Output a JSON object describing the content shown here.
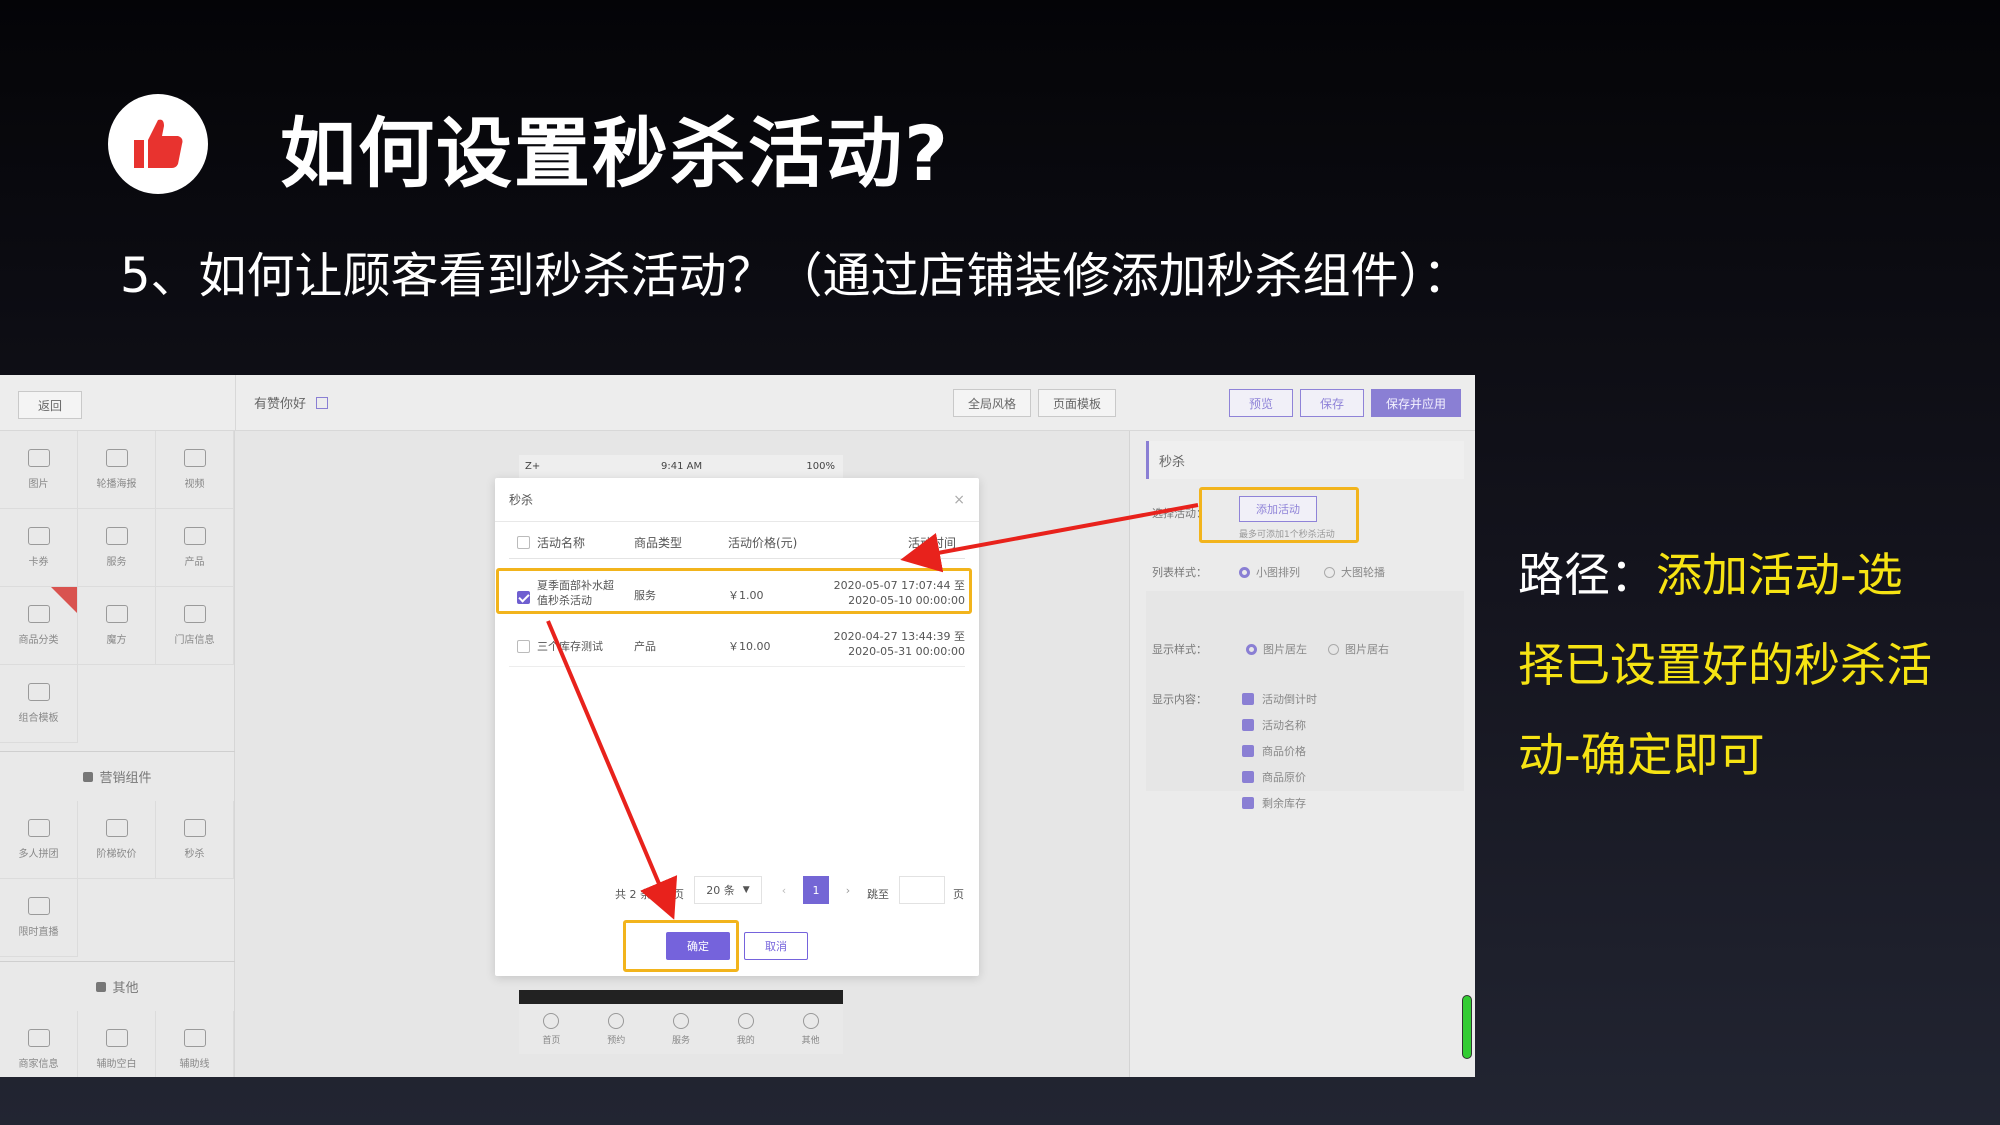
{
  "slide": {
    "title": "如何设置秒杀活动?",
    "subtitle": "5、如何让顾客看到秒杀活动？（通过店铺装修添加秒杀组件）：",
    "path_label": "路径：",
    "path_line1": "添加活动-选",
    "path_line2": "择已设置好的秒杀活",
    "path_line3": "动-确定即可",
    "accent_color": "#f6e313",
    "icon": "thumbs-up-icon"
  },
  "editor": {
    "back_label": "返回",
    "store_name": "有赞你好",
    "global_style": "全局风格",
    "page_template": "页面模板",
    "preview": "预览",
    "save": "保存",
    "save_apply": "保存并应用",
    "components": [
      "图片",
      "轮播海报",
      "视频",
      "卡券",
      "服务",
      "产品",
      "商品分类",
      "魔方",
      "门店信息",
      "组合模板"
    ],
    "marketing_group": "营销组件",
    "marketing_items": [
      "多人拼团",
      "阶梯砍价",
      "秒杀",
      "限时直播"
    ],
    "other_group": "其他",
    "other_items": [
      "商家信息",
      "辅助空白",
      "辅助线"
    ],
    "phone_status": {
      "carrier": "Z+",
      "time": "9:41 AM",
      "battery": "100%"
    },
    "phone_tabs": [
      "首页",
      "预约",
      "服务",
      "我的",
      "其他"
    ],
    "panel_title": "秒杀",
    "select_activity_label": "选择活动：",
    "add_activity": "添加活动",
    "add_hint": "最多可添加1个秒杀活动",
    "list_style_label": "列表样式：",
    "list_style_options": [
      "小图排列",
      "大图轮播"
    ],
    "display_style_label": "显示样式：",
    "display_style_options": [
      "图片居左",
      "图片居右"
    ],
    "display_content_label": "显示内容：",
    "display_content_options": [
      "活动倒计时",
      "活动名称",
      "商品价格",
      "商品原价",
      "剩余库存"
    ]
  },
  "modal": {
    "title": "秒杀",
    "close": "×",
    "headers": [
      "活动名称",
      "商品类型",
      "活动价格(元)",
      "活动时间"
    ],
    "rows": [
      {
        "name_line1": "夏季面部补水超",
        "name_line2": "值秒杀活动",
        "type": "服务",
        "price": "￥1.00",
        "time_start": "2020-05-07 17:07:44 至",
        "time_end": "2020-05-10 00:00:00",
        "checked": true
      },
      {
        "name_line1": "三个库存测试",
        "name_line2": "",
        "type": "产品",
        "price": "￥10.00",
        "time_start": "2020-04-27 13:44:39 至",
        "time_end": "2020-05-31 00:00:00",
        "checked": false
      }
    ],
    "total": "共 2 条，每页",
    "page_size": "20 条",
    "current_page": "1",
    "goto_label": "跳至",
    "page_unit": "页",
    "confirm": "确定",
    "cancel": "取消"
  }
}
